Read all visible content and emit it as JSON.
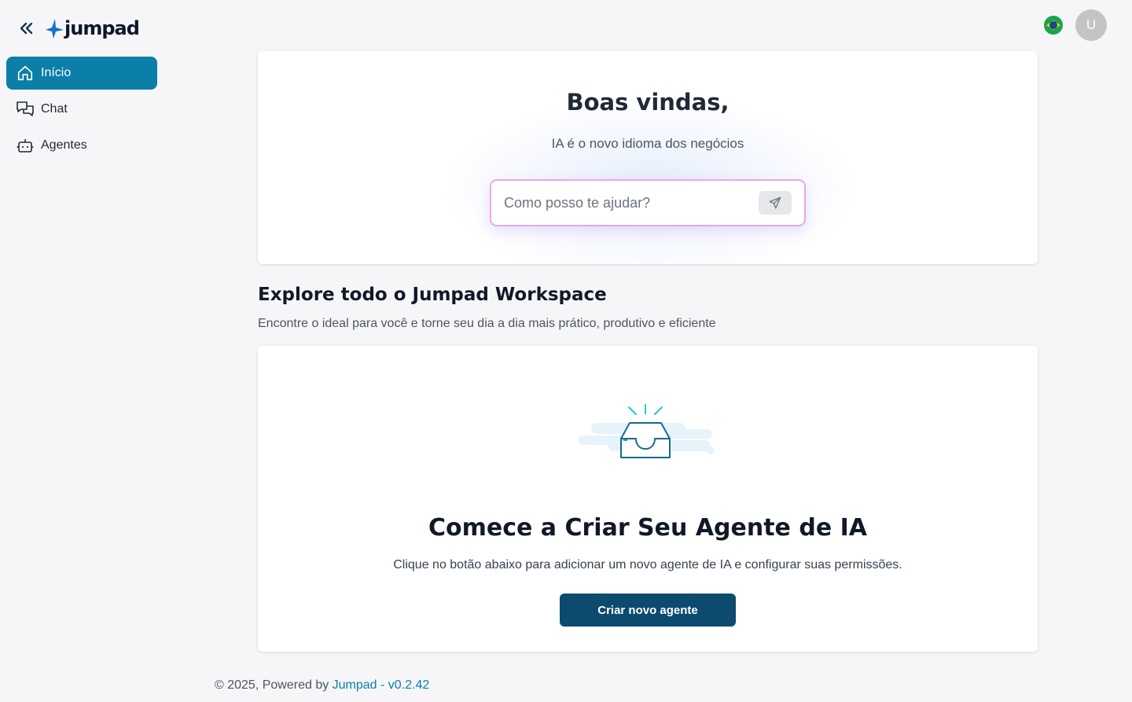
{
  "app": {
    "brand": "jumpad",
    "accent_color": "#0b7fa8",
    "dark_button_color": "#0c4a6e"
  },
  "sidebar": {
    "collapse_icon": "double-chevron-left-icon",
    "items": [
      {
        "label": "Início",
        "icon": "home-icon",
        "active": true
      },
      {
        "label": "Chat",
        "icon": "chat-bubbles-icon",
        "active": false
      },
      {
        "label": "Agentes",
        "icon": "robot-icon",
        "active": false
      }
    ]
  },
  "header": {
    "language_icon": "brazil-flag-icon",
    "avatar_initial": "U"
  },
  "hero": {
    "title": "Boas vindas,",
    "subtitle": "IA é o novo idioma dos negócios",
    "prompt_placeholder": "Como posso te ajudar?",
    "send_icon": "send-icon"
  },
  "explore": {
    "title": "Explore todo o Jumpad Workspace",
    "subtitle": "Encontre o ideal para você e torne seu dia a dia mais prático, produtivo e eficiente"
  },
  "empty_state": {
    "illustration": "empty-inbox-icon",
    "title": "Comece a Criar Seu Agente de IA",
    "subtitle": "Clique no botão abaixo para adicionar um novo agente de IA e configurar suas permissões.",
    "button_label": "Criar novo agente"
  },
  "footer": {
    "prefix": "© 2025, Powered by ",
    "link_text": "Jumpad - v0.2.42"
  }
}
